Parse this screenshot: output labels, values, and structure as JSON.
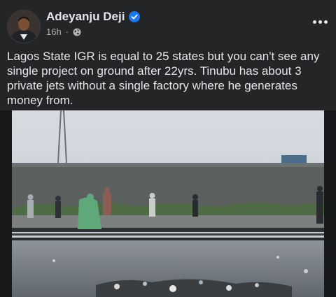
{
  "post": {
    "author": {
      "name": "Adeyanju Deji",
      "verified": true,
      "avatar_icon": "profile-photo"
    },
    "timestamp": "16h",
    "separator": "·",
    "audience_icon": "globe-icon",
    "more_icon": "more-options-icon",
    "text": "Lagos State IGR is equal to 25 states but you can't see any single project on ground after 22yrs. Tinubu has about 3 private jets without a single factory where he generates money from.",
    "media": {
      "kind": "photo",
      "subject": "flooded rail line with debris and people in rain coats"
    }
  },
  "colors": {
    "background": "#242526",
    "text_primary": "#e4e6eb",
    "text_secondary": "#b0b3b8",
    "verified_blue": "#1877f2"
  }
}
